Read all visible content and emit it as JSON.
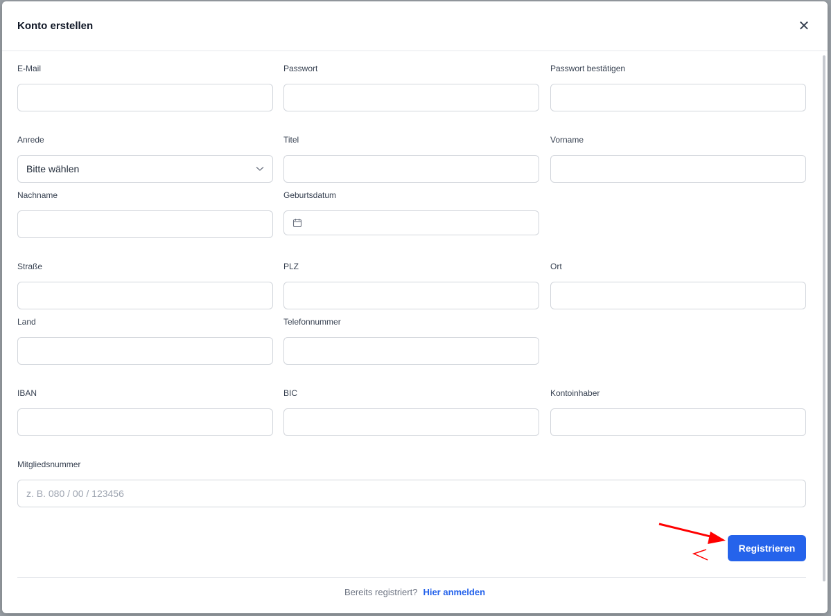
{
  "modal": {
    "title": "Konto erstellen",
    "close_icon": "close-icon"
  },
  "fields": {
    "email": {
      "label": "E-Mail",
      "value": ""
    },
    "password": {
      "label": "Passwort",
      "value": ""
    },
    "password_confirm": {
      "label": "Passwort bestätigen",
      "value": ""
    },
    "salutation": {
      "label": "Anrede",
      "selected": "Bitte wählen"
    },
    "title": {
      "label": "Titel",
      "value": ""
    },
    "firstname": {
      "label": "Vorname",
      "value": ""
    },
    "lastname": {
      "label": "Nachname",
      "value": ""
    },
    "birthdate": {
      "label": "Geburtsdatum",
      "value": ""
    },
    "street": {
      "label": "Straße",
      "value": ""
    },
    "zip": {
      "label": "PLZ",
      "value": ""
    },
    "city": {
      "label": "Ort",
      "value": ""
    },
    "country": {
      "label": "Land",
      "value": ""
    },
    "phone": {
      "label": "Telefonnummer",
      "value": ""
    },
    "iban": {
      "label": "IBAN",
      "value": ""
    },
    "bic": {
      "label": "BIC",
      "value": ""
    },
    "account_holder": {
      "label": "Kontoinhaber",
      "value": ""
    },
    "member_number": {
      "label": "Mitgliedsnummer",
      "placeholder": "z. B. 080 / 00 / 123456"
    }
  },
  "actions": {
    "register_label": "Registrieren"
  },
  "footer": {
    "text": "Bereits registriert?",
    "link": "Hier anmelden"
  },
  "colors": {
    "primary": "#2563eb",
    "annotation": "#ff0000"
  }
}
